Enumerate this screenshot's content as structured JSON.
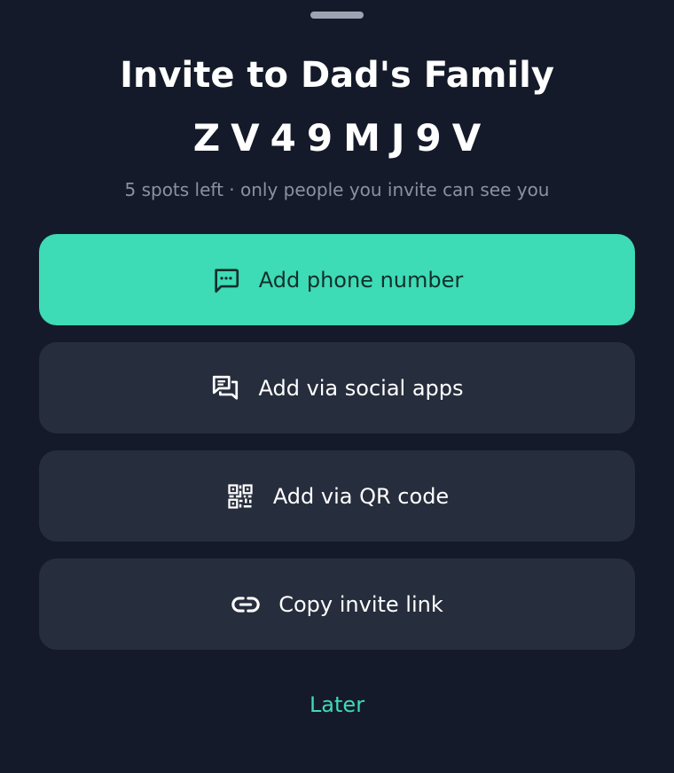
{
  "sheet": {
    "title": "Invite to Dad's Family",
    "invite_code": "ZV49MJ9V",
    "subtitle": "5 spots left · only people you invite can see you"
  },
  "actions": [
    {
      "label": "Add phone number",
      "icon": "message-icon",
      "style": "primary"
    },
    {
      "label": "Add via social apps",
      "icon": "chat-icon",
      "style": "secondary"
    },
    {
      "label": "Add via QR code",
      "icon": "qr-code-icon",
      "style": "secondary"
    },
    {
      "label": "Copy invite link",
      "icon": "link-icon",
      "style": "secondary"
    }
  ],
  "later_label": "Later",
  "colors": {
    "background": "#141a29",
    "card": "#262d3c",
    "accent": "#3ddbb6",
    "muted_text": "#8a91a0"
  }
}
